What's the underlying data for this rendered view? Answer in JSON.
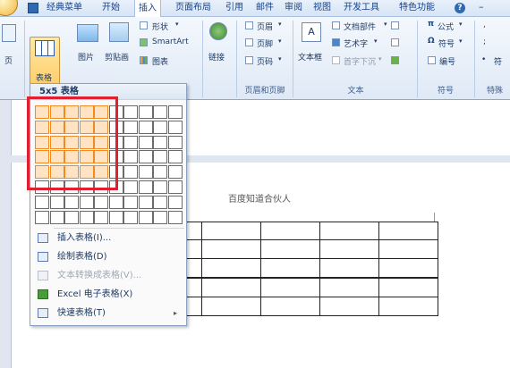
{
  "menubar": {
    "tabs": [
      {
        "label": "经典菜单"
      },
      {
        "label": "开始"
      },
      {
        "label": "插入"
      },
      {
        "label": "页面布局"
      },
      {
        "label": "引用"
      },
      {
        "label": "邮件"
      },
      {
        "label": "审阅"
      },
      {
        "label": "视图"
      },
      {
        "label": "开发工具"
      },
      {
        "label": "特色功能"
      }
    ],
    "active_tab": "插入",
    "help_glyph": "?",
    "min_glyph": "–"
  },
  "ribbon": {
    "page_label": "页",
    "table_label": "表格",
    "picture_label": "图片",
    "clipart_label": "剪贴画",
    "shapes_label": "形状",
    "smartart_label": "SmartArt",
    "chart_label": "图表",
    "link_label": "链接",
    "header_label": "页眉",
    "footer_label": "页脚",
    "pagenum_label": "页码",
    "group_header_footer": "页眉和页脚",
    "textbox_label": "文本框",
    "docparts_label": "文档部件",
    "wordart_label": "艺术字",
    "dropcap_label": "首字下沉",
    "group_text": "文本",
    "formula_label": "公式",
    "symbol_label": "符号",
    "number_label": "编号",
    "group_symbol": "符号",
    "group_special": "特殊",
    "special_item": "符",
    "punct1": ",",
    "punct2": ";",
    "bullet": "•"
  },
  "dropdown": {
    "title": "5x5 表格",
    "grid_cols": 10,
    "grid_rows": 8,
    "selected_cols": 5,
    "selected_rows": 5,
    "items": [
      {
        "label": "插入表格(I)...",
        "icon": "insert-table-icon",
        "enabled": true
      },
      {
        "label": "绘制表格(D)",
        "icon": "draw-table-icon",
        "enabled": true
      },
      {
        "label": "文本转换成表格(V)...",
        "icon": "text-to-table-icon",
        "enabled": false
      },
      {
        "label": "Excel 电子表格(X)",
        "icon": "excel-icon",
        "enabled": true
      },
      {
        "label": "快速表格(T)",
        "icon": "quick-table-icon",
        "enabled": true,
        "submenu_arrow": "▸"
      }
    ]
  },
  "document": {
    "header_text": "百度知道合伙人",
    "table_rows": 5,
    "table_cols": 5
  },
  "colors": {
    "highlight_border": "#f08a24",
    "highlight_fill": "#ffe3c2",
    "annotation_red": "#e02030"
  }
}
